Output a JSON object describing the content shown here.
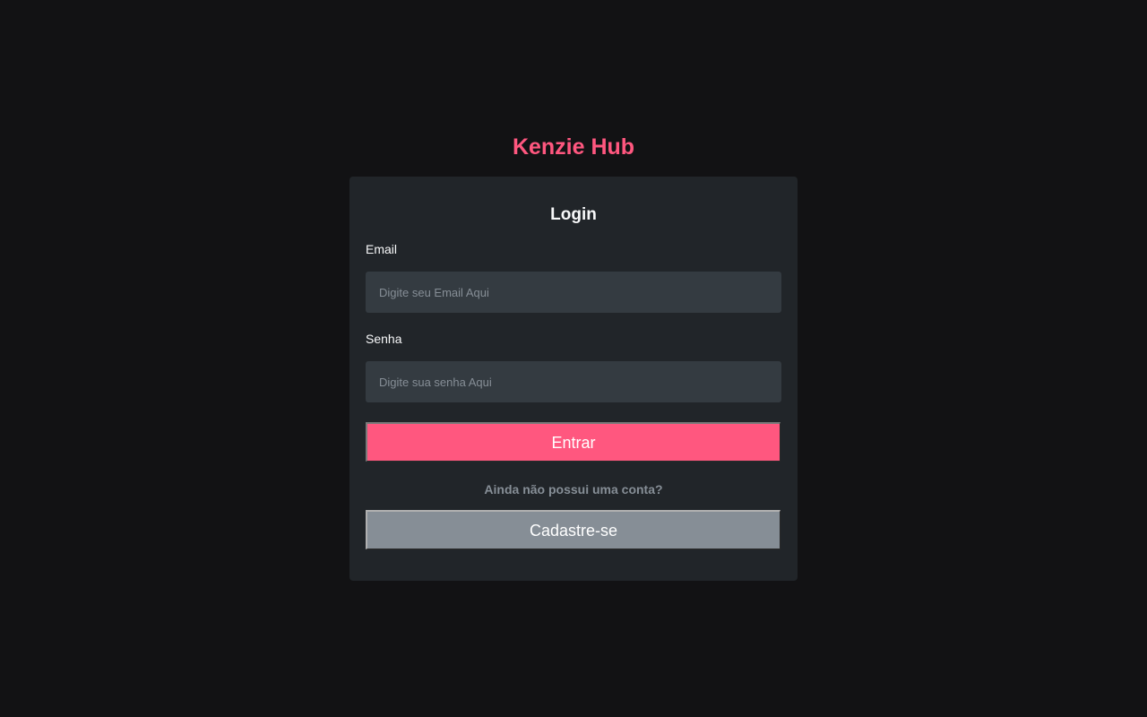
{
  "app": {
    "brand": "Kenzie Hub"
  },
  "login": {
    "title": "Login",
    "email_label": "Email",
    "email_placeholder": "Digite seu Email Aqui",
    "password_label": "Senha",
    "password_placeholder": "Digite sua senha Aqui",
    "submit_label": "Entrar",
    "signup_prompt": "Ainda não possui uma conta?",
    "signup_label": "Cadastre-se"
  },
  "colors": {
    "background": "#121214",
    "card": "#212529",
    "input": "#343B41",
    "accent": "#FF577F",
    "muted": "#868E96",
    "text": "#F8F9FA"
  }
}
